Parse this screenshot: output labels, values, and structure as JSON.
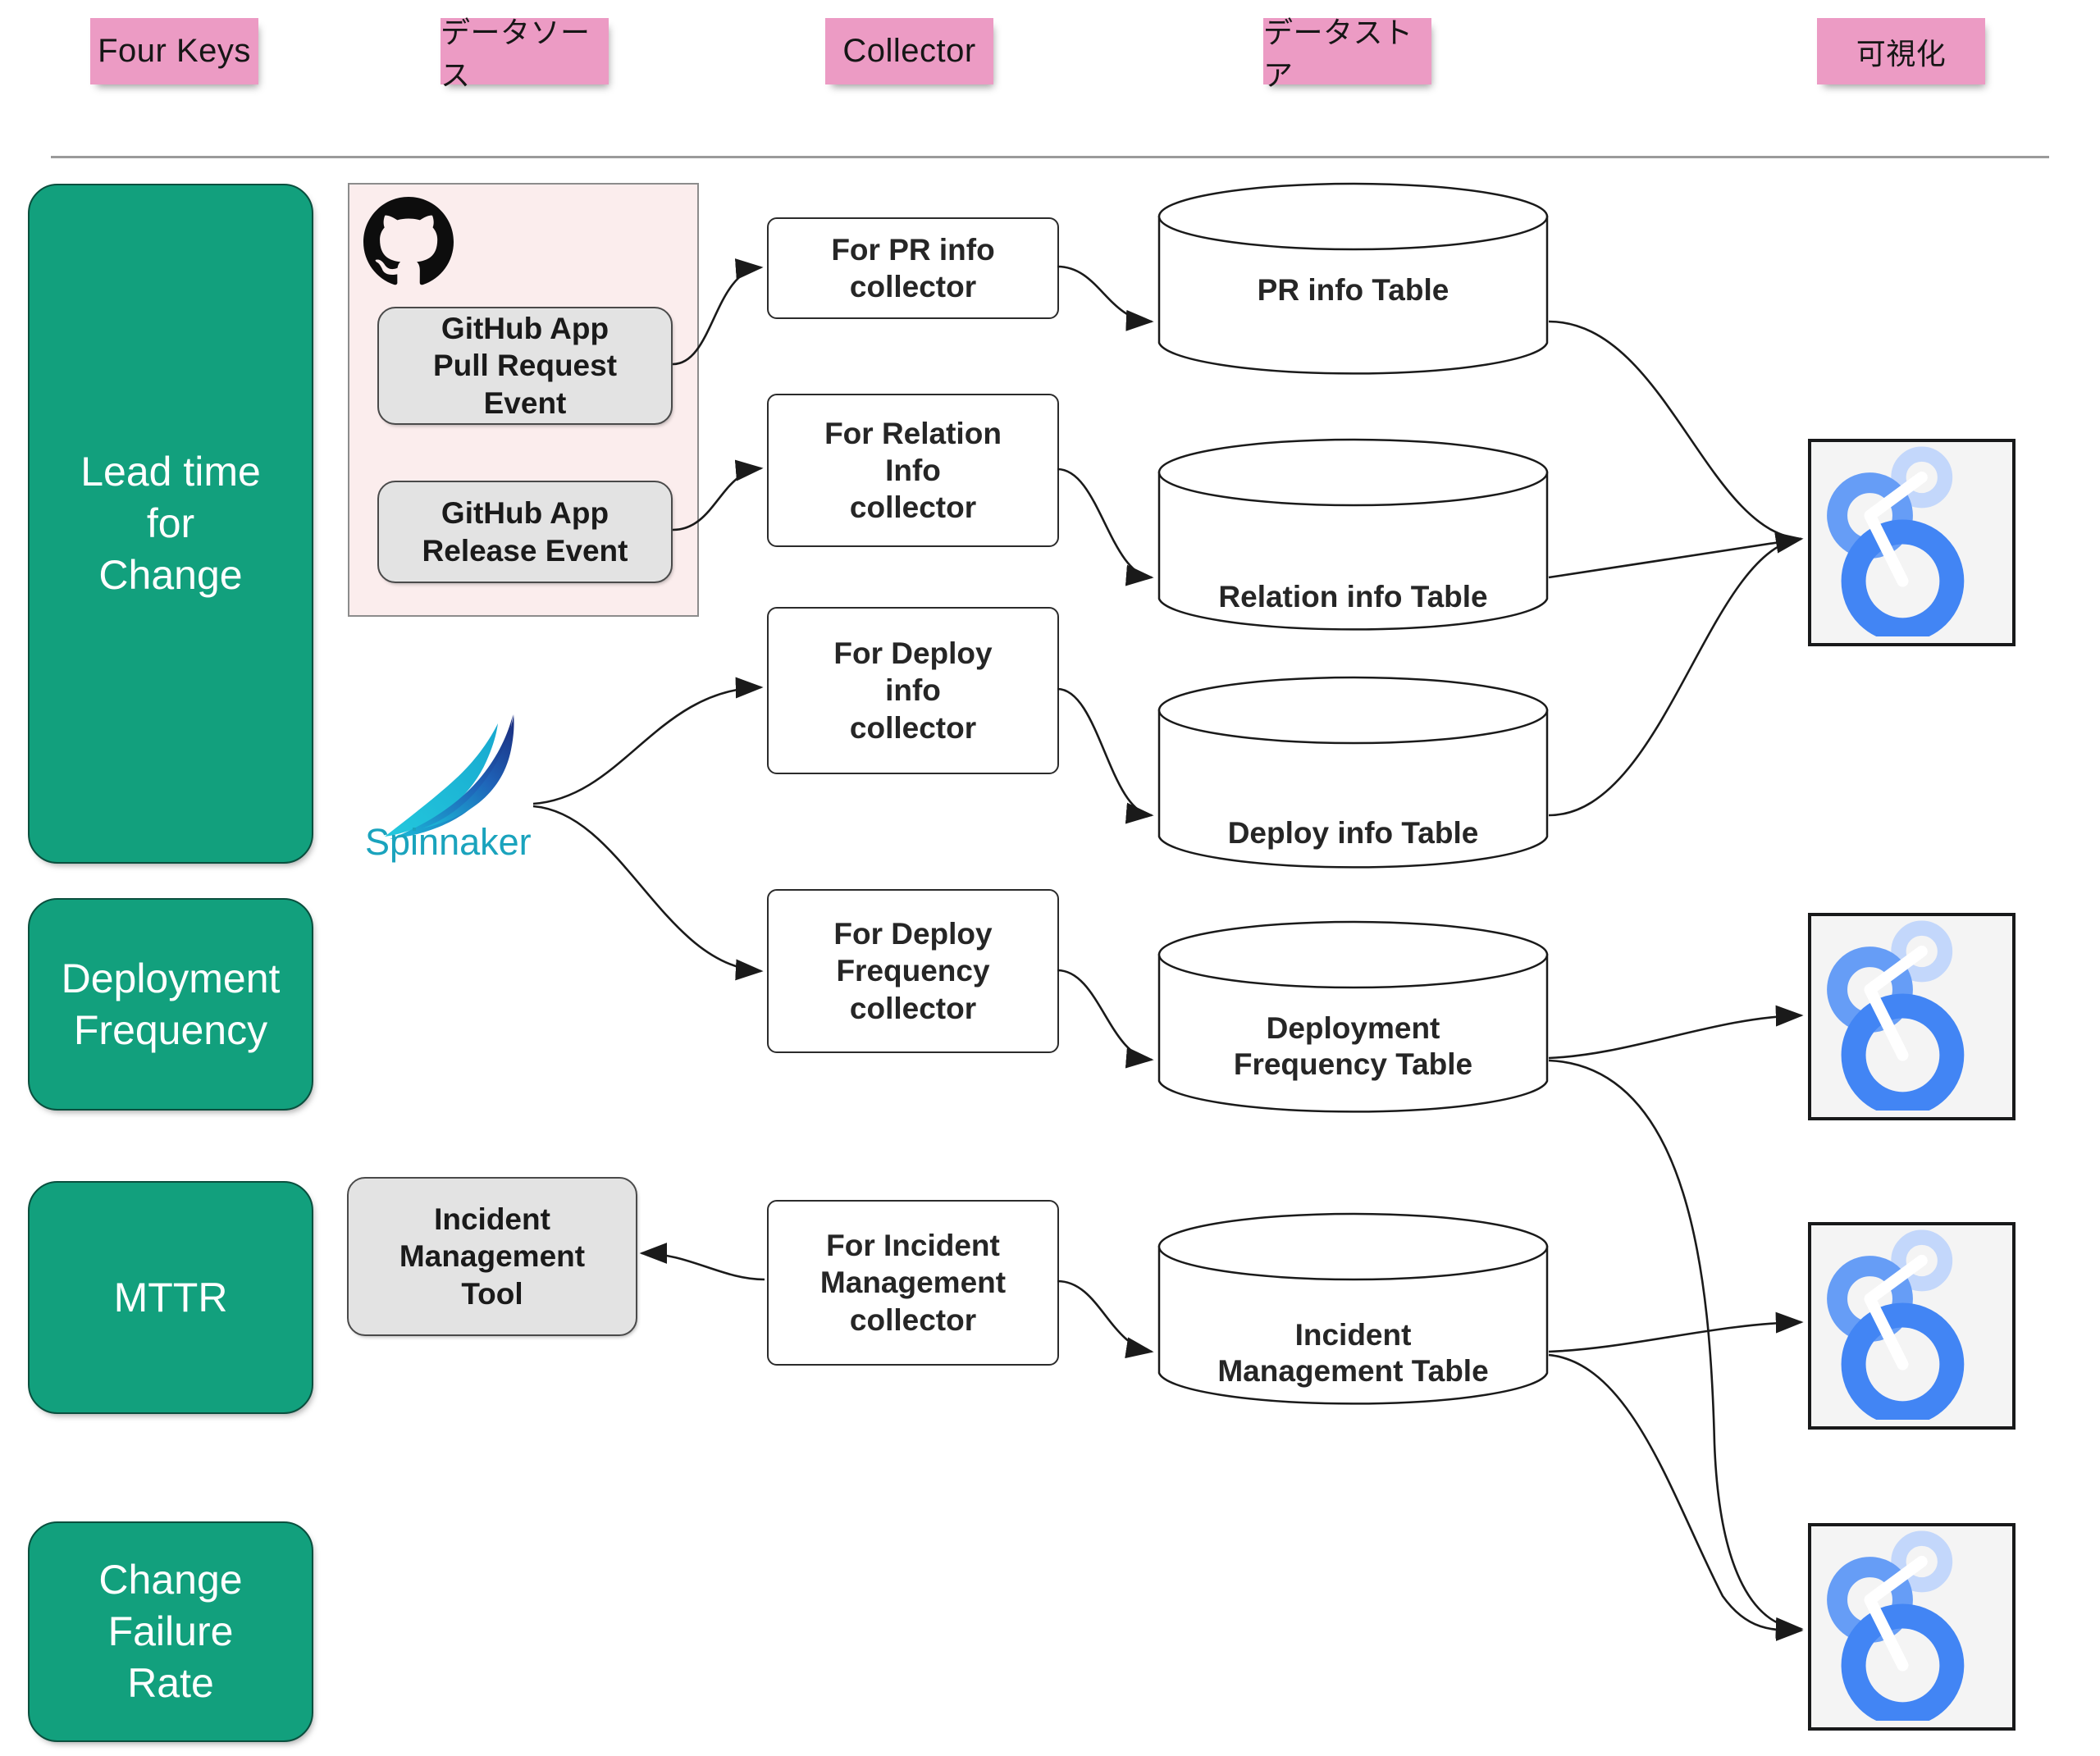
{
  "header": {
    "columns": [
      {
        "label": "Four Keys",
        "lang": "en"
      },
      {
        "label": "データソース",
        "lang": "ja"
      },
      {
        "label": "Collector",
        "lang": "en"
      },
      {
        "label": "データストア",
        "lang": "ja"
      },
      {
        "label": "可視化",
        "lang": "ja"
      }
    ]
  },
  "four_keys": [
    {
      "label": "Lead time\nfor\nChange"
    },
    {
      "label": "Deployment\nFrequency"
    },
    {
      "label": "MTTR"
    },
    {
      "label": "Change\nFailure\nRate"
    }
  ],
  "data_sources": {
    "github_group": {
      "icon": "github-logo-icon",
      "items": [
        {
          "label": "GitHub App\nPull Request\nEvent"
        },
        {
          "label": "GitHub App\nRelease Event"
        }
      ]
    },
    "spinnaker": {
      "icon": "spinnaker-logo-icon",
      "label": "Spinnaker"
    },
    "incident_tool": {
      "label": "Incident\nManagement\nTool"
    }
  },
  "collectors": [
    {
      "label": "For PR info\ncollector"
    },
    {
      "label": "For Relation\nInfo\ncollector"
    },
    {
      "label": "For Deploy\ninfo\ncollector"
    },
    {
      "label": "For Deploy\nFrequency\ncollector"
    },
    {
      "label": "For Incident\nManagement\ncollector"
    }
  ],
  "data_stores": [
    {
      "label": "PR info Table"
    },
    {
      "label": "Relation info Table"
    },
    {
      "label": "Deploy info Table"
    },
    {
      "label": "Deployment\nFrequency Table"
    },
    {
      "label": "Incident\nManagement Table"
    }
  ],
  "visualizations": [
    {
      "icon": "looker-studio-icon"
    },
    {
      "icon": "looker-studio-icon"
    },
    {
      "icon": "looker-studio-icon"
    },
    {
      "icon": "looker-studio-icon"
    }
  ],
  "colors": {
    "sticky_pink": "#ec9bc4",
    "four_keys_green": "#12a07d",
    "datasource_panel": "#fbeded",
    "datasource_box": "#e3e3e3",
    "viz_tile_bg": "#f4f4f4",
    "looker_blue": "#4285f4",
    "looker_blue_mid": "#669df6",
    "looker_blue_light": "#c3d7fb",
    "spinnaker_cyan": "#25c6da",
    "spinnaker_navy": "#1b3a8c",
    "edge_stroke": "#1a1a1a"
  }
}
